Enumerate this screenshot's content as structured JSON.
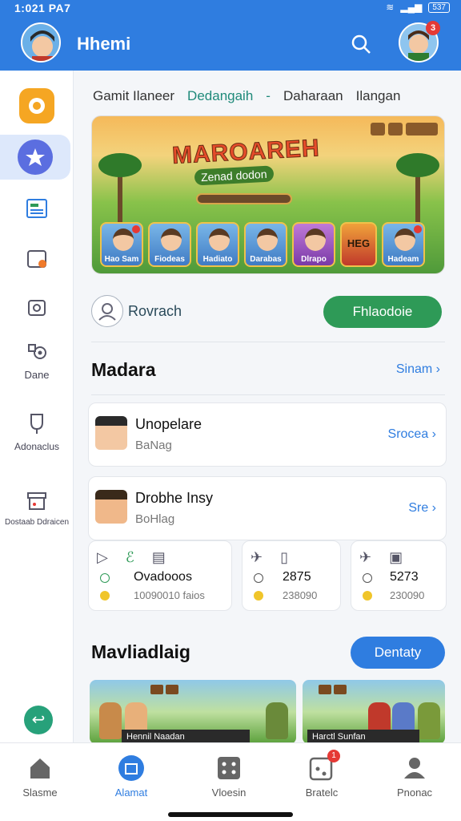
{
  "status_bar": {
    "time": "1:021 PA7",
    "battery": "537"
  },
  "app_bar": {
    "title": "Hhemi"
  },
  "profile": {
    "badge": "3"
  },
  "sidebar": {
    "items": [
      {
        "label": "",
        "icon": "chat-bubble-icon"
      },
      {
        "label": "",
        "icon": "star-game-icon"
      },
      {
        "label": "",
        "icon": "news-icon"
      },
      {
        "label": "",
        "icon": "calendar-icon"
      },
      {
        "label": "",
        "icon": "camera-icon"
      },
      {
        "label": "Dane",
        "icon": "gear-people-icon"
      },
      {
        "label": "Adonaclus",
        "icon": "trophy-icon"
      },
      {
        "label": "Dostaab Ddraicen",
        "icon": "shop-icon"
      }
    ]
  },
  "tabs": [
    "Gamit Ilaneer",
    "Dedangaih",
    "-",
    "Daharaan",
    "Ilangan"
  ],
  "banner": {
    "title": "MAROAREH",
    "subtitle": "Zenad dodon",
    "heroes": [
      "Hao Sam",
      "Fiodeas",
      "Hadiato",
      "Darabas",
      "Dlrapo",
      "HEG",
      "Hadeam"
    ]
  },
  "search_row": {
    "text": "Rovrach",
    "button": "Fhlaodoie"
  },
  "section1": {
    "title": "Madara",
    "link": "Sinam"
  },
  "list": [
    {
      "title": "Unopelare",
      "subtitle": "BaNag",
      "link": "Srocea"
    },
    {
      "title": "Drobhe Insy",
      "subtitle": "BoHlag",
      "link": "Sre"
    }
  ],
  "stats": [
    {
      "value": "Ovadooos",
      "sub": "10090010 faios"
    },
    {
      "value": "2875",
      "sub": "238090"
    },
    {
      "value": "5273",
      "sub": "230090"
    }
  ],
  "section2": {
    "title": "Mavliadlaig",
    "button": "Dentaty"
  },
  "game_tiles": [
    "Hennil Naadan",
    "Harctl Sunfan"
  ],
  "bottom_nav": [
    "Slasme",
    "Alamat",
    "Vloesin",
    "Bratelc",
    "Pnonac"
  ],
  "nav_badge": "1",
  "colors": {
    "primary": "#2f7de0",
    "green": "#2e9a57",
    "accent_red": "#e53935"
  }
}
